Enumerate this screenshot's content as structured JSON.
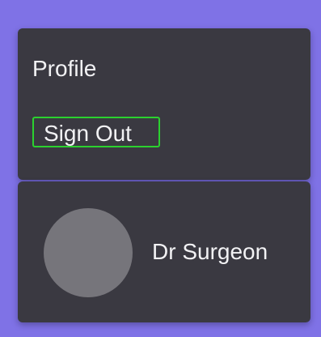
{
  "menu": {
    "items": [
      {
        "label": "Profile"
      },
      {
        "label": "Sign Out"
      }
    ],
    "focused_item": "Sign Out"
  },
  "profile": {
    "name": "Dr Surgeon"
  },
  "colors": {
    "background": "#7f72e6",
    "panel": "#3a3941",
    "text": "#f2f2f4",
    "focus_outline": "#2bd12f",
    "avatar": "#76757b"
  }
}
